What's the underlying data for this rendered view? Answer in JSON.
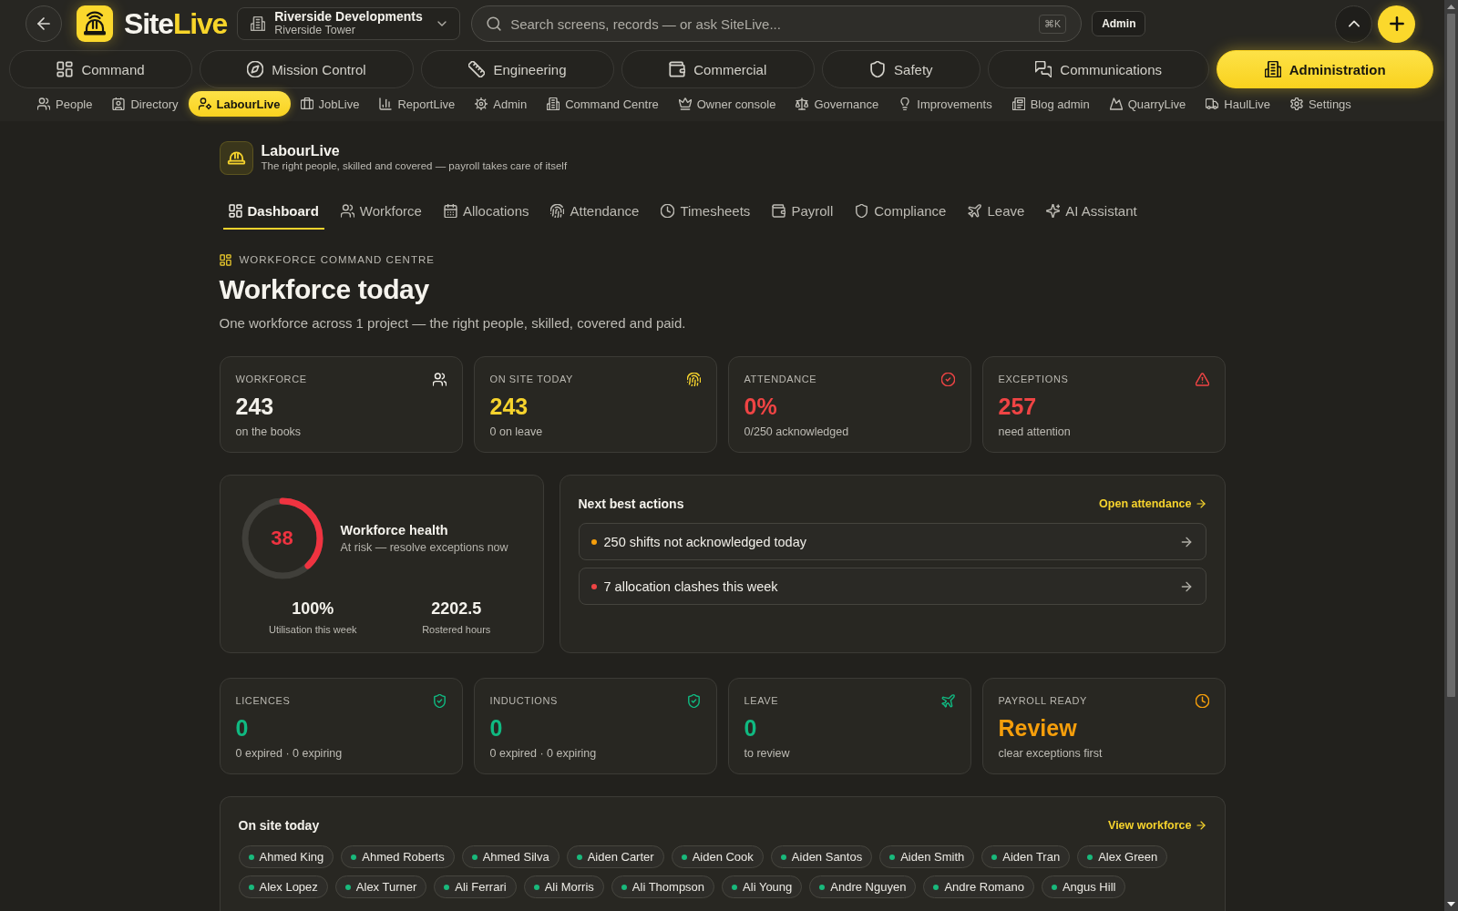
{
  "topbar": {
    "logo": {
      "first": "Site",
      "second": "Live"
    },
    "project": {
      "name": "Riverside Developments",
      "site": "Riverside Tower"
    },
    "search": {
      "placeholder": "Search screens, records — or ask SiteLive...",
      "shortcut": "⌘K"
    },
    "role_badge": "Admin"
  },
  "module_tabs": [
    {
      "label": "Command",
      "selected": false
    },
    {
      "label": "Mission Control",
      "selected": false
    },
    {
      "label": "Engineering",
      "selected": false
    },
    {
      "label": "Commercial",
      "selected": false
    },
    {
      "label": "Safety",
      "selected": false
    },
    {
      "label": "Communications",
      "selected": false
    },
    {
      "label": "Administration",
      "selected": true
    }
  ],
  "sub_nav": [
    {
      "label": "People",
      "selected": false
    },
    {
      "label": "Directory",
      "selected": false
    },
    {
      "label": "LabourLive",
      "selected": true
    },
    {
      "label": "JobLive",
      "selected": false
    },
    {
      "label": "ReportLive",
      "selected": false
    },
    {
      "label": "Admin",
      "selected": false
    },
    {
      "label": "Command Centre",
      "selected": false
    },
    {
      "label": "Owner console",
      "selected": false
    },
    {
      "label": "Governance",
      "selected": false
    },
    {
      "label": "Improvements",
      "selected": false
    },
    {
      "label": "Blog admin",
      "selected": false
    },
    {
      "label": "QuarryLive",
      "selected": false
    },
    {
      "label": "HaulLive",
      "selected": false
    },
    {
      "label": "Settings",
      "selected": false
    }
  ],
  "app": {
    "name": "LabourLive",
    "tagline": "The right people, skilled and covered — payroll takes care of itself"
  },
  "app_tabs": [
    {
      "label": "Dashboard",
      "selected": true
    },
    {
      "label": "Workforce",
      "selected": false
    },
    {
      "label": "Allocations",
      "selected": false
    },
    {
      "label": "Attendance",
      "selected": false
    },
    {
      "label": "Timesheets",
      "selected": false
    },
    {
      "label": "Payroll",
      "selected": false
    },
    {
      "label": "Compliance",
      "selected": false
    },
    {
      "label": "Leave",
      "selected": false
    },
    {
      "label": "AI Assistant",
      "selected": false
    }
  ],
  "page": {
    "eyebrow": "WORKFORCE COMMAND CENTRE",
    "title": "Workforce today",
    "description": "One workforce across 1 project — the right people, skilled, covered and paid."
  },
  "stats": [
    {
      "label": "WORKFORCE",
      "value": "243",
      "caption": "on the books",
      "color": "#f2f0ea"
    },
    {
      "label": "ON SITE TODAY",
      "value": "243",
      "caption": "0 on leave",
      "color": "#f6d32d"
    },
    {
      "label": "ATTENDANCE",
      "value": "0%",
      "caption": "0/250 acknowledged",
      "color": "#ef4444"
    },
    {
      "label": "EXCEPTIONS",
      "value": "257",
      "caption": "need attention",
      "color": "#ef4444"
    }
  ],
  "health": {
    "score": "38",
    "level": 0.38,
    "title": "Workforce health",
    "status": "At risk — resolve exceptions now",
    "metrics": [
      {
        "value": "100%",
        "label": "Utilisation this week"
      },
      {
        "value": "2202.5",
        "label": "Rostered hours"
      }
    ]
  },
  "next_actions": {
    "title": "Next best actions",
    "link": "Open attendance",
    "items": [
      {
        "text": "250 shifts not acknowledged today",
        "color": "#f59e0b"
      },
      {
        "text": "7 allocation clashes this week",
        "color": "#ef4444"
      }
    ]
  },
  "compliance_stats": [
    {
      "label": "LICENCES",
      "value": "0",
      "caption": "0 expired · 0 expiring",
      "color": "#10b981"
    },
    {
      "label": "INDUCTIONS",
      "value": "0",
      "caption": "0 expired · 0 expiring",
      "color": "#10b981"
    },
    {
      "label": "LEAVE",
      "value": "0",
      "caption": "to review",
      "color": "#10b981"
    },
    {
      "label": "PAYROLL READY",
      "value": "Review",
      "caption": "clear exceptions first",
      "color": "#f59e0b"
    }
  ],
  "on_site": {
    "title": "On site today",
    "link": "View workforce",
    "people": [
      "Ahmed King",
      "Ahmed Roberts",
      "Ahmed Silva",
      "Aiden Carter",
      "Aiden Cook",
      "Aiden Santos",
      "Aiden Smith",
      "Aiden Tran",
      "Alex Green",
      "Alex Lopez",
      "Alex Turner",
      "Ali Ferrari",
      "Ali Morris",
      "Ali Thompson",
      "Ali Young",
      "Andre Nguyen",
      "Andre Romano",
      "Angus Hill"
    ]
  }
}
